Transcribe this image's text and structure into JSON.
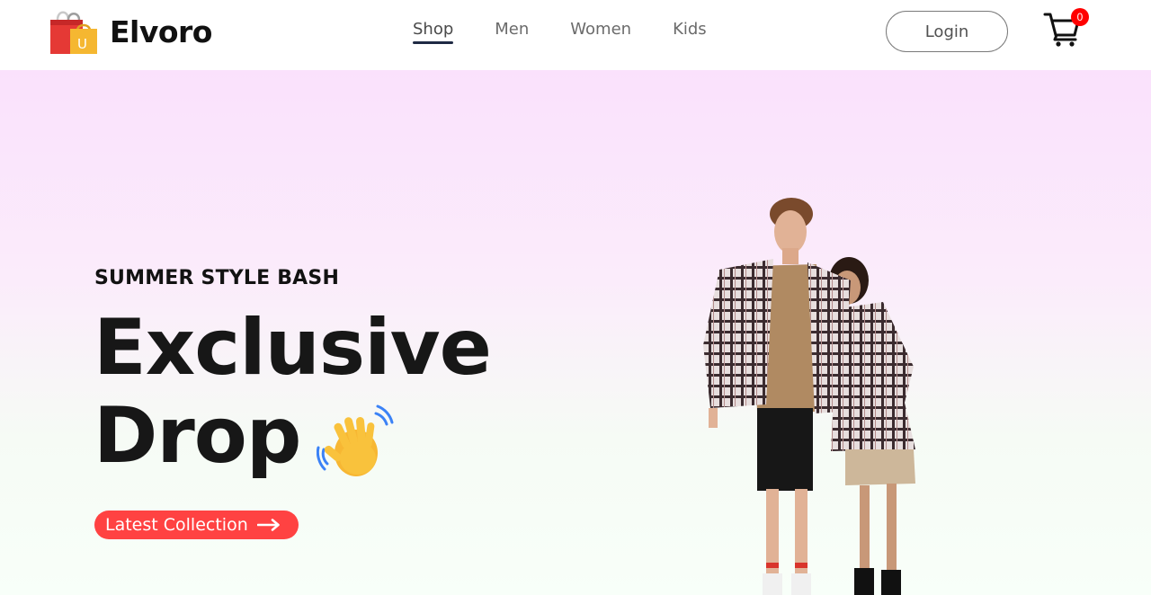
{
  "header": {
    "brand": "Elvoro",
    "logo_icon": "shopping-bags-icon",
    "logo_letter": "U",
    "nav": [
      {
        "label": "Shop",
        "active": true
      },
      {
        "label": "Men",
        "active": false
      },
      {
        "label": "Women",
        "active": false
      },
      {
        "label": "Kids",
        "active": false
      }
    ],
    "login_label": "Login",
    "cart_icon": "cart-icon",
    "cart_count": "0"
  },
  "hero": {
    "eyebrow": "SUMMER STYLE BASH",
    "headline_line1": "Exclusive",
    "headline_line2": "Drop",
    "emoji_icon": "waving-hand-icon",
    "cta_label": "Latest Collection",
    "cta_icon": "arrow-right-icon",
    "image": "models-in-plaid-shirts"
  },
  "colors": {
    "accent": "#ff4242",
    "badge": "#ff0000",
    "nav_underline": "#1f2a44",
    "hero_top": "#fae1fc",
    "hero_bottom": "#f8fff9"
  }
}
